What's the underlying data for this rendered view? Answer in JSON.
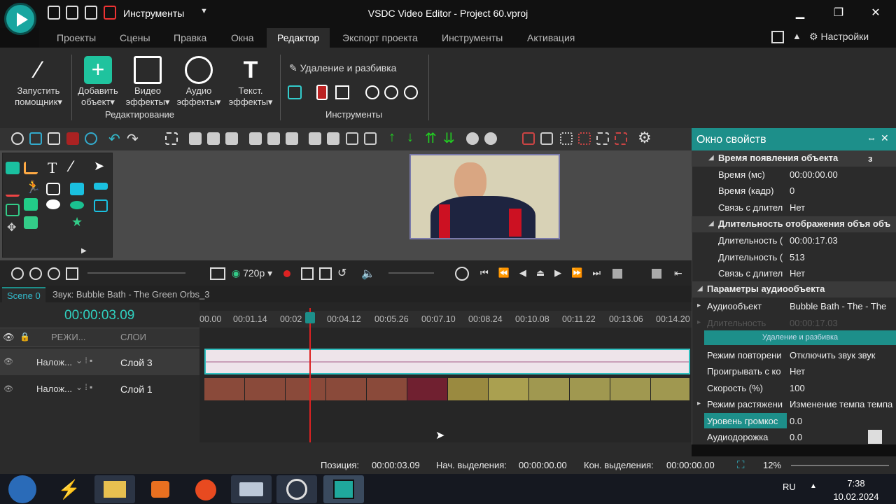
{
  "window": {
    "title": "VSDC Video Editor - Project 60.vproj",
    "workspace": "Инструменты",
    "minimize": "▁",
    "maximize": "❐",
    "close": "✕"
  },
  "menu": {
    "tabs": [
      "Проекты",
      "Сцены",
      "Правка",
      "Окна",
      "Редактор",
      "Экспорт проекта",
      "Инструменты",
      "Активация"
    ],
    "active": "Редактор",
    "settings": "Настройки"
  },
  "ribbon": {
    "buttons": [
      {
        "l1": "Запустить",
        "l2": "помощник"
      },
      {
        "l1": "Добавить",
        "l2": "объект"
      },
      {
        "l1": "Видео",
        "l2": "эффекты"
      },
      {
        "l1": "Аудио",
        "l2": "эффекты"
      },
      {
        "l1": "Текст.",
        "l2": "эффекты"
      }
    ],
    "group_edit": "Редактирование",
    "delete_split": "Удаление и разбивка",
    "group_tools": "Инструменты"
  },
  "properties": {
    "title": "Окно свойств",
    "sec_time": "Время появления объекта",
    "sec_time_extra": "з",
    "time_ms_k": "Время (мс)",
    "time_ms_v": "00:00:00.00",
    "time_fr_k": "Время (кадр)",
    "time_fr_v": "0",
    "link1_k": "Связь с длител",
    "link1_v": "Нет",
    "sec_dur": "Длительность отображения объя объ",
    "dur1_k": "Длительность (",
    "dur1_v": "00:00:17.03",
    "dur2_k": "Длительность (",
    "dur2_v": "513",
    "link2_k": "Связь с длител",
    "link2_v": "Нет",
    "sec_audio": "Параметры аудиообъекта",
    "audio_obj_k": "Аудиообъект",
    "audio_obj_v": "Bubble Bath - The - The",
    "dim_k": "Длительность",
    "dim_v": "00:00:17.03",
    "delete_split_btn": "Удаление и разбивка",
    "repeat_k": "Режим повторени",
    "repeat_v": "Отключить звук  звук",
    "playback_k": "Проигрывать с ко",
    "playback_v": "Нет",
    "speed_k": "Скорость (%)",
    "speed_v": "100",
    "stretch_k": "Режим растяжени",
    "stretch_v": "Изменение темпа темпа",
    "volume_k": "Уровень громкос",
    "volume_v": "0.0",
    "track_k": "Аудиодорожка",
    "track_v": "0.0"
  },
  "timeline": {
    "resolution": "720p",
    "tab_scene": "Scene 0",
    "tab_sound": "Звук: Bubble Bath - The Green Orbs_3",
    "current_time": "00:00:03.09",
    "ruler": [
      "00.00",
      "00:01.14",
      "00:02",
      "00:04.12",
      "00:05.26",
      "00:07.10",
      "00:08.24",
      "00:10.08",
      "00:11.22",
      "00:13.06",
      "00:14.20"
    ],
    "header_mode": "РЕЖИ...",
    "header_layers": "СЛОИ",
    "layer3_blend": "Налож...",
    "layer3_name": "Слой 3",
    "layer1_blend": "Налож...",
    "layer1_name": "Слой 1"
  },
  "status": {
    "pos_label": "Позиция:",
    "pos_value": "00:00:03.09",
    "sel_start_label": "Нач. выделения:",
    "sel_start_value": "00:00:00.00",
    "sel_end_label": "Кон. выделения:",
    "sel_end_value": "00:00:00.00",
    "zoom": "12%"
  },
  "taskbar": {
    "lang": "RU",
    "time": "7:38",
    "date": "10.02.2024"
  }
}
